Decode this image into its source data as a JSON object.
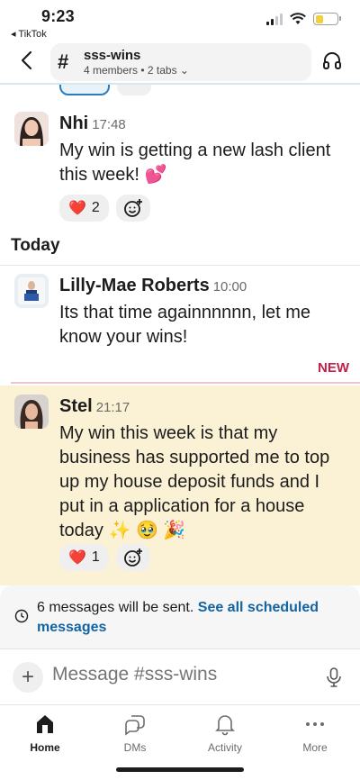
{
  "status_bar": {
    "time": "9:23",
    "back_app": "◂ TikTok"
  },
  "header": {
    "channel_name": "sss-wins",
    "meta": "4 members • 2 tabs ⌄"
  },
  "messages": [
    {
      "author": "Nhi",
      "time": "17:48",
      "text": "My win is getting a new lash client this week! 💕",
      "reactions": [
        {
          "emoji": "❤️",
          "count": "2"
        }
      ]
    },
    {
      "author": "Lilly-Mae Roberts",
      "time": "10:00",
      "text": "Its that time againnnnnn, let me know your wins!",
      "reactions": []
    },
    {
      "author": "Stel",
      "time": "21:17",
      "text": "My win this week is that my business has supported me to top up my house deposit funds and I put in a application for a house today ✨ 🥹 🎉",
      "reactions": [
        {
          "emoji": "❤️",
          "count": "1"
        }
      ]
    }
  ],
  "day_divider": "Today",
  "new_marker": "NEW",
  "scheduled": {
    "text": "6 messages will be sent.",
    "link": "See all scheduled messages"
  },
  "composer": {
    "placeholder": "Message #sss-wins"
  },
  "tabs": [
    {
      "label": "Home",
      "icon": "home-icon",
      "active": true
    },
    {
      "label": "DMs",
      "icon": "dms-icon",
      "active": false
    },
    {
      "label": "Activity",
      "icon": "bell-icon",
      "active": false
    },
    {
      "label": "More",
      "icon": "more-icon",
      "active": false
    }
  ],
  "colors": {
    "link": "#1264a3",
    "new_marker": "#c41e4a",
    "highlight_bg": "#fbf1d5"
  }
}
